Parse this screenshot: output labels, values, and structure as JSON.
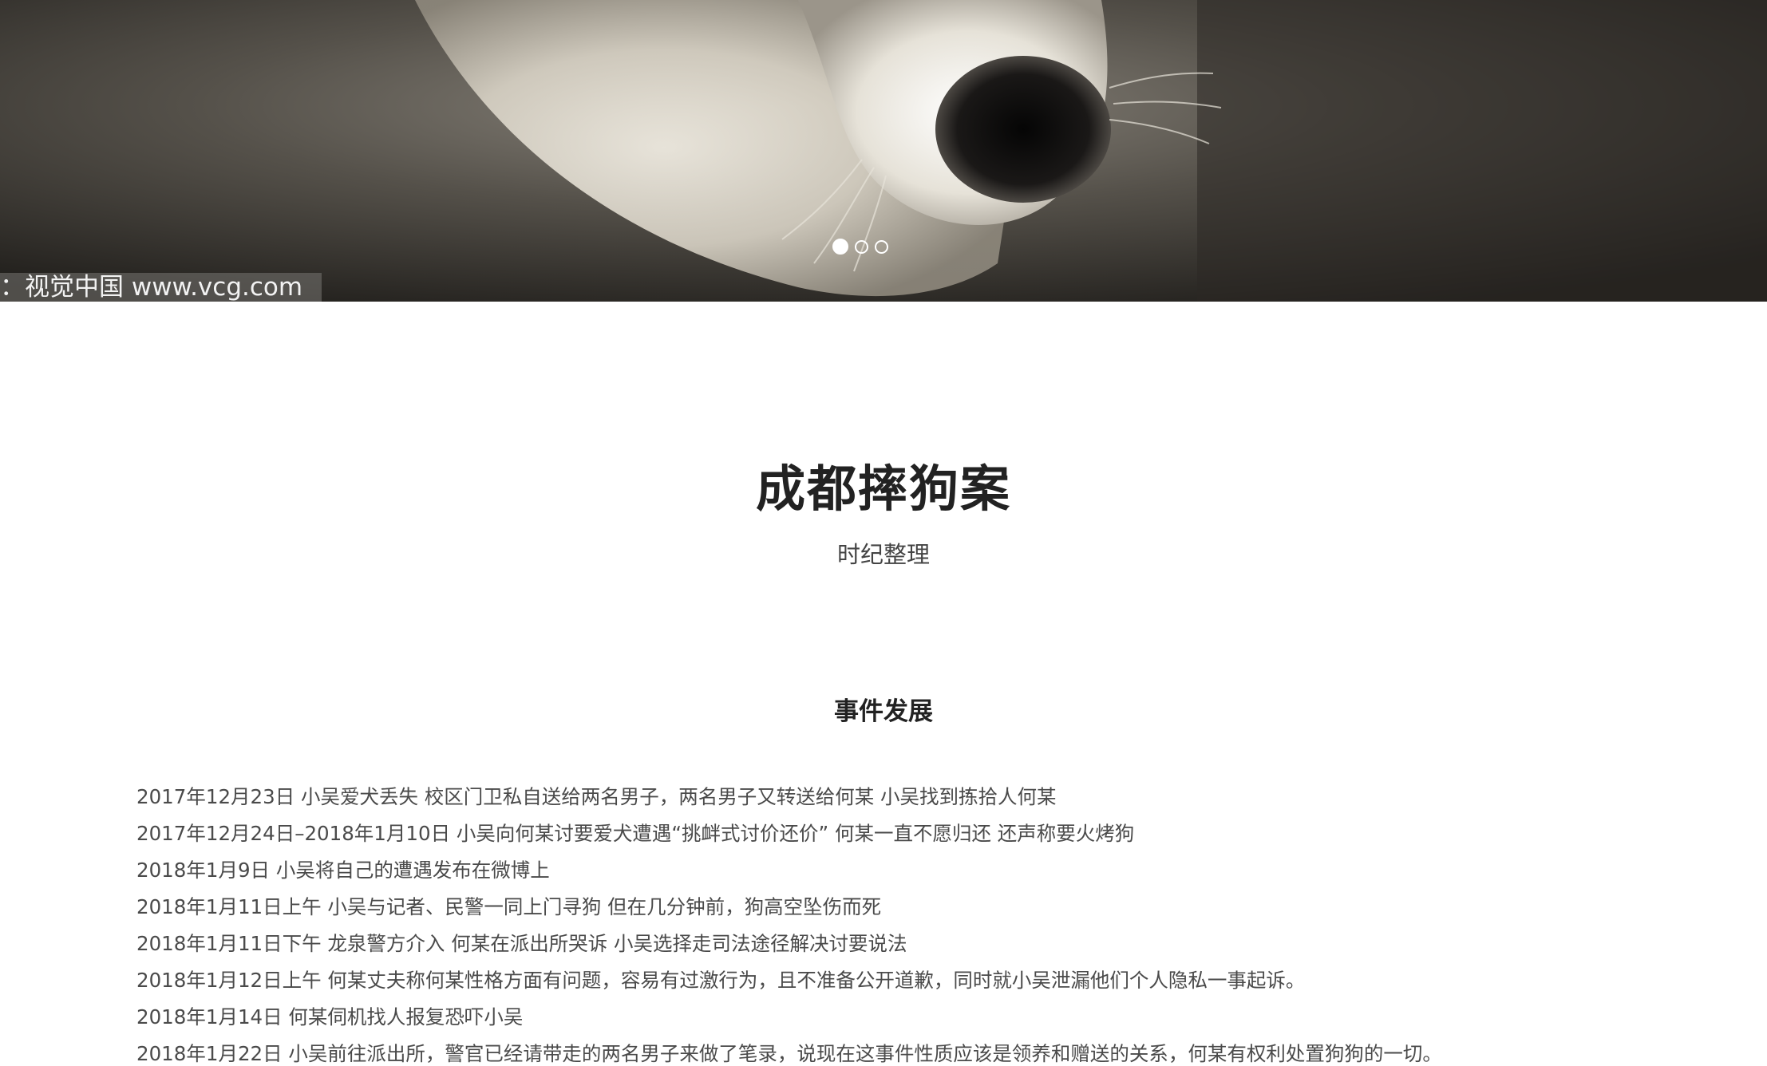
{
  "hero": {
    "watermark": "：视觉中国 www.vcg.com",
    "carousel": {
      "slide_count": 3,
      "active_index": 0
    }
  },
  "article": {
    "title": "成都摔狗案",
    "subtitle": "时纪整理",
    "section_heading": "事件发展",
    "events": [
      "2017年12月23日 小吴爱犬丢失 校区门卫私自送给两名男子，两名男子又转送给何某 小吴找到拣拾人何某",
      "2017年12月24日–2018年1月10日 小吴向何某讨要爱犬遭遇“挑衅式讨价还价” 何某一直不愿归还 还声称要火烤狗",
      "2018年1月9日 小吴将自己的遭遇发布在微博上",
      "2018年1月11日上午 小吴与记者、民警一同上门寻狗 但在几分钟前，狗高空坠伤而死",
      "2018年1月11日下午 龙泉警方介入 何某在派出所哭诉 小吴选择走司法途径解决讨要说法",
      "2018年1月12日上午 何某丈夫称何某性格方面有问题，容易有过激行为，且不准备公开道歉，同时就小吴泄漏他们个人隐私一事起诉。",
      "2018年1月14日 何某伺机找人报复恐吓小吴",
      "2018年1月22日 小吴前往派出所，警官已经请带走的两名男子来做了笔录，说现在这事件性质应该是领养和赠送的关系，何某有权利处置狗狗的一切。"
    ]
  }
}
